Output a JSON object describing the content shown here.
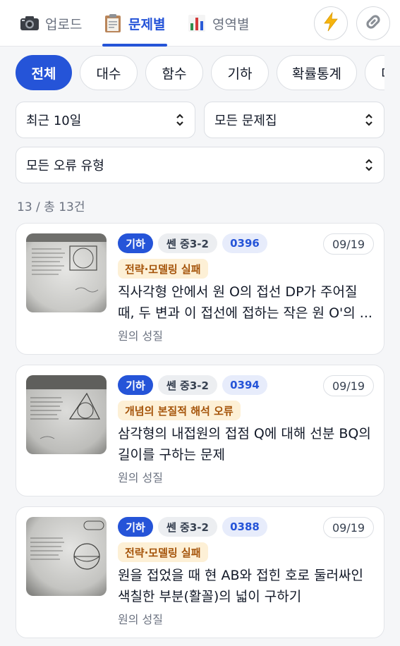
{
  "nav": {
    "tabs": [
      {
        "label": "업로드",
        "icon": "camera-icon"
      },
      {
        "label": "문제별",
        "icon": "clipboard-icon"
      },
      {
        "label": "영역별",
        "icon": "bar-chart-icon"
      }
    ],
    "active_tab": "문제별",
    "actions": [
      {
        "icon": "lightning-icon"
      },
      {
        "icon": "link-icon"
      }
    ]
  },
  "categories": [
    "전체",
    "대수",
    "함수",
    "기하",
    "확률통계",
    "미적분"
  ],
  "active_category": "전체",
  "filters": {
    "period": "최근 10일",
    "workbook": "모든 문제집",
    "error_type": "모든 오류 유형"
  },
  "count_text": "13 / 총 13건",
  "colors": {
    "accent": "#2554d8",
    "error_bg": "#fdf0d6",
    "error_text": "#a5540a"
  },
  "cards": [
    {
      "area": "기하",
      "workbook": "쎈 중3-2",
      "problem_no": "0396",
      "date": "09/19",
      "error": "전략·모델링 실패",
      "description": "직사각형 안에서 원 O의 접선 DP가 주어질 때, 두 변과 이 접선에 접하는 작은 원 O'의 ...",
      "unit": "원의 성질"
    },
    {
      "area": "기하",
      "workbook": "쎈 중3-2",
      "problem_no": "0394",
      "date": "09/19",
      "error": "개념의 본질적 해석 오류",
      "description": "삼각형의 내접원의 접점 Q에 대해 선분 BQ의 길이를 구하는 문제",
      "unit": "원의 성질"
    },
    {
      "area": "기하",
      "workbook": "쎈 중3-2",
      "problem_no": "0388",
      "date": "09/19",
      "error": "전략·모델링 실패",
      "description": "원을 접었을 때 현 AB와 접힌 호로 둘러싸인 색칠한 부분(활꼴)의 넓이 구하기",
      "unit": "원의 성질"
    }
  ]
}
